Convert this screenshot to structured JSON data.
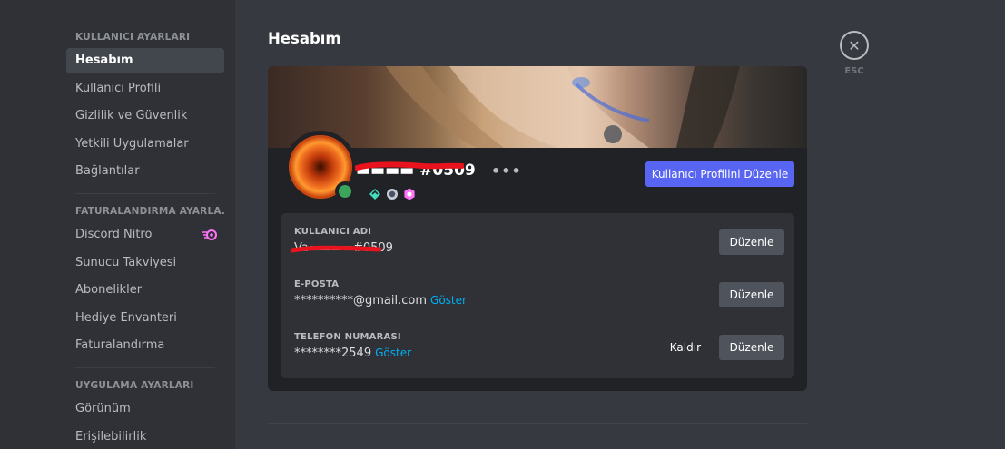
{
  "sidebar": {
    "sections": [
      {
        "header": "KULLANICI AYARLARI",
        "items": [
          {
            "label": "Hesabım",
            "active": true
          },
          {
            "label": "Kullanıcı Profili"
          },
          {
            "label": "Gizlilik ve Güvenlik"
          },
          {
            "label": "Yetkili Uygulamalar"
          },
          {
            "label": "Bağlantılar"
          }
        ]
      },
      {
        "header": "FATURALANDIRMA AYARLA...",
        "items": [
          {
            "label": "Discord Nitro",
            "icon": "nitro-icon"
          },
          {
            "label": "Sunucu Takviyesi"
          },
          {
            "label": "Abonelikler"
          },
          {
            "label": "Hediye Envanteri"
          },
          {
            "label": "Faturalandırma"
          }
        ]
      },
      {
        "header": "UYGULAMA AYARLARI",
        "items": [
          {
            "label": "Görünüm"
          },
          {
            "label": "Erişilebilirlik"
          }
        ]
      }
    ]
  },
  "main": {
    "title": "Hesabım",
    "close_label": "ESC",
    "profile": {
      "username": "▬▬▬▬ #0509",
      "more": "•••",
      "edit_profile_label": "Kullanıcı Profilini Düzenle",
      "badges": [
        "hypesquad-icon",
        "boost-icon",
        "nitro-badge-icon"
      ]
    },
    "fields": [
      {
        "label": "KULLANICI ADI",
        "value": "Va▬▬▬▬#0509",
        "show": "",
        "button": "Düzenle"
      },
      {
        "label": "E-POSTA",
        "value": "**********@gmail.com",
        "show": "Göster",
        "button": "Düzenle"
      },
      {
        "label": "TELEFON NUMARASI",
        "value": "********2549",
        "show": "Göster",
        "remove": "Kaldır",
        "button": "Düzenle"
      }
    ]
  },
  "colors": {
    "accent": "#5865f2",
    "status_online": "#3ba55c",
    "link": "#00aff4"
  }
}
